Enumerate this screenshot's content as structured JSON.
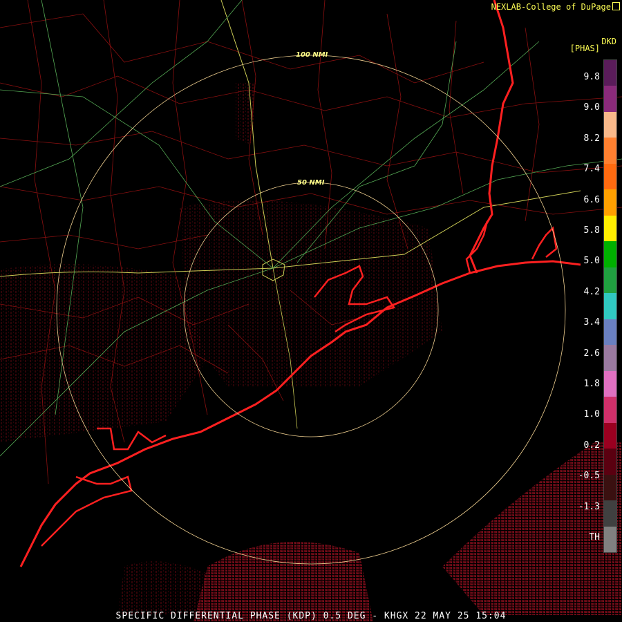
{
  "header": {
    "credit": "NEXLAB-College of DuPage",
    "unit_code": "DKD",
    "unit_name": "[PHAS]"
  },
  "range_rings": [
    {
      "label": "100 NMI"
    },
    {
      "label": "50 NMI"
    }
  ],
  "legend": {
    "ticks": [
      "9.8",
      "9.0",
      "8.2",
      "7.4",
      "6.6",
      "5.8",
      "5.0",
      "4.2",
      "3.4",
      "2.6",
      "1.8",
      "1.0",
      "0.2",
      "-0.5",
      "-1.3",
      "TH"
    ],
    "colors": [
      "#5a1c5a",
      "#8a2a7a",
      "#f8b88a",
      "#ff8030",
      "#ff6a10",
      "#ffa000",
      "#ffee00",
      "#00b000",
      "#20a040",
      "#30c8c0",
      "#6a80c0",
      "#9a7aa0",
      "#e070c0",
      "#d0306a",
      "#9a0020",
      "#5a0010",
      "#3a1010",
      "#404040",
      "#808080"
    ]
  },
  "footer": {
    "title": "SPECIFIC DIFFERENTIAL PHASE (KDP) 0.5 DEG - KHGX 22 MAY 25 15:04"
  }
}
